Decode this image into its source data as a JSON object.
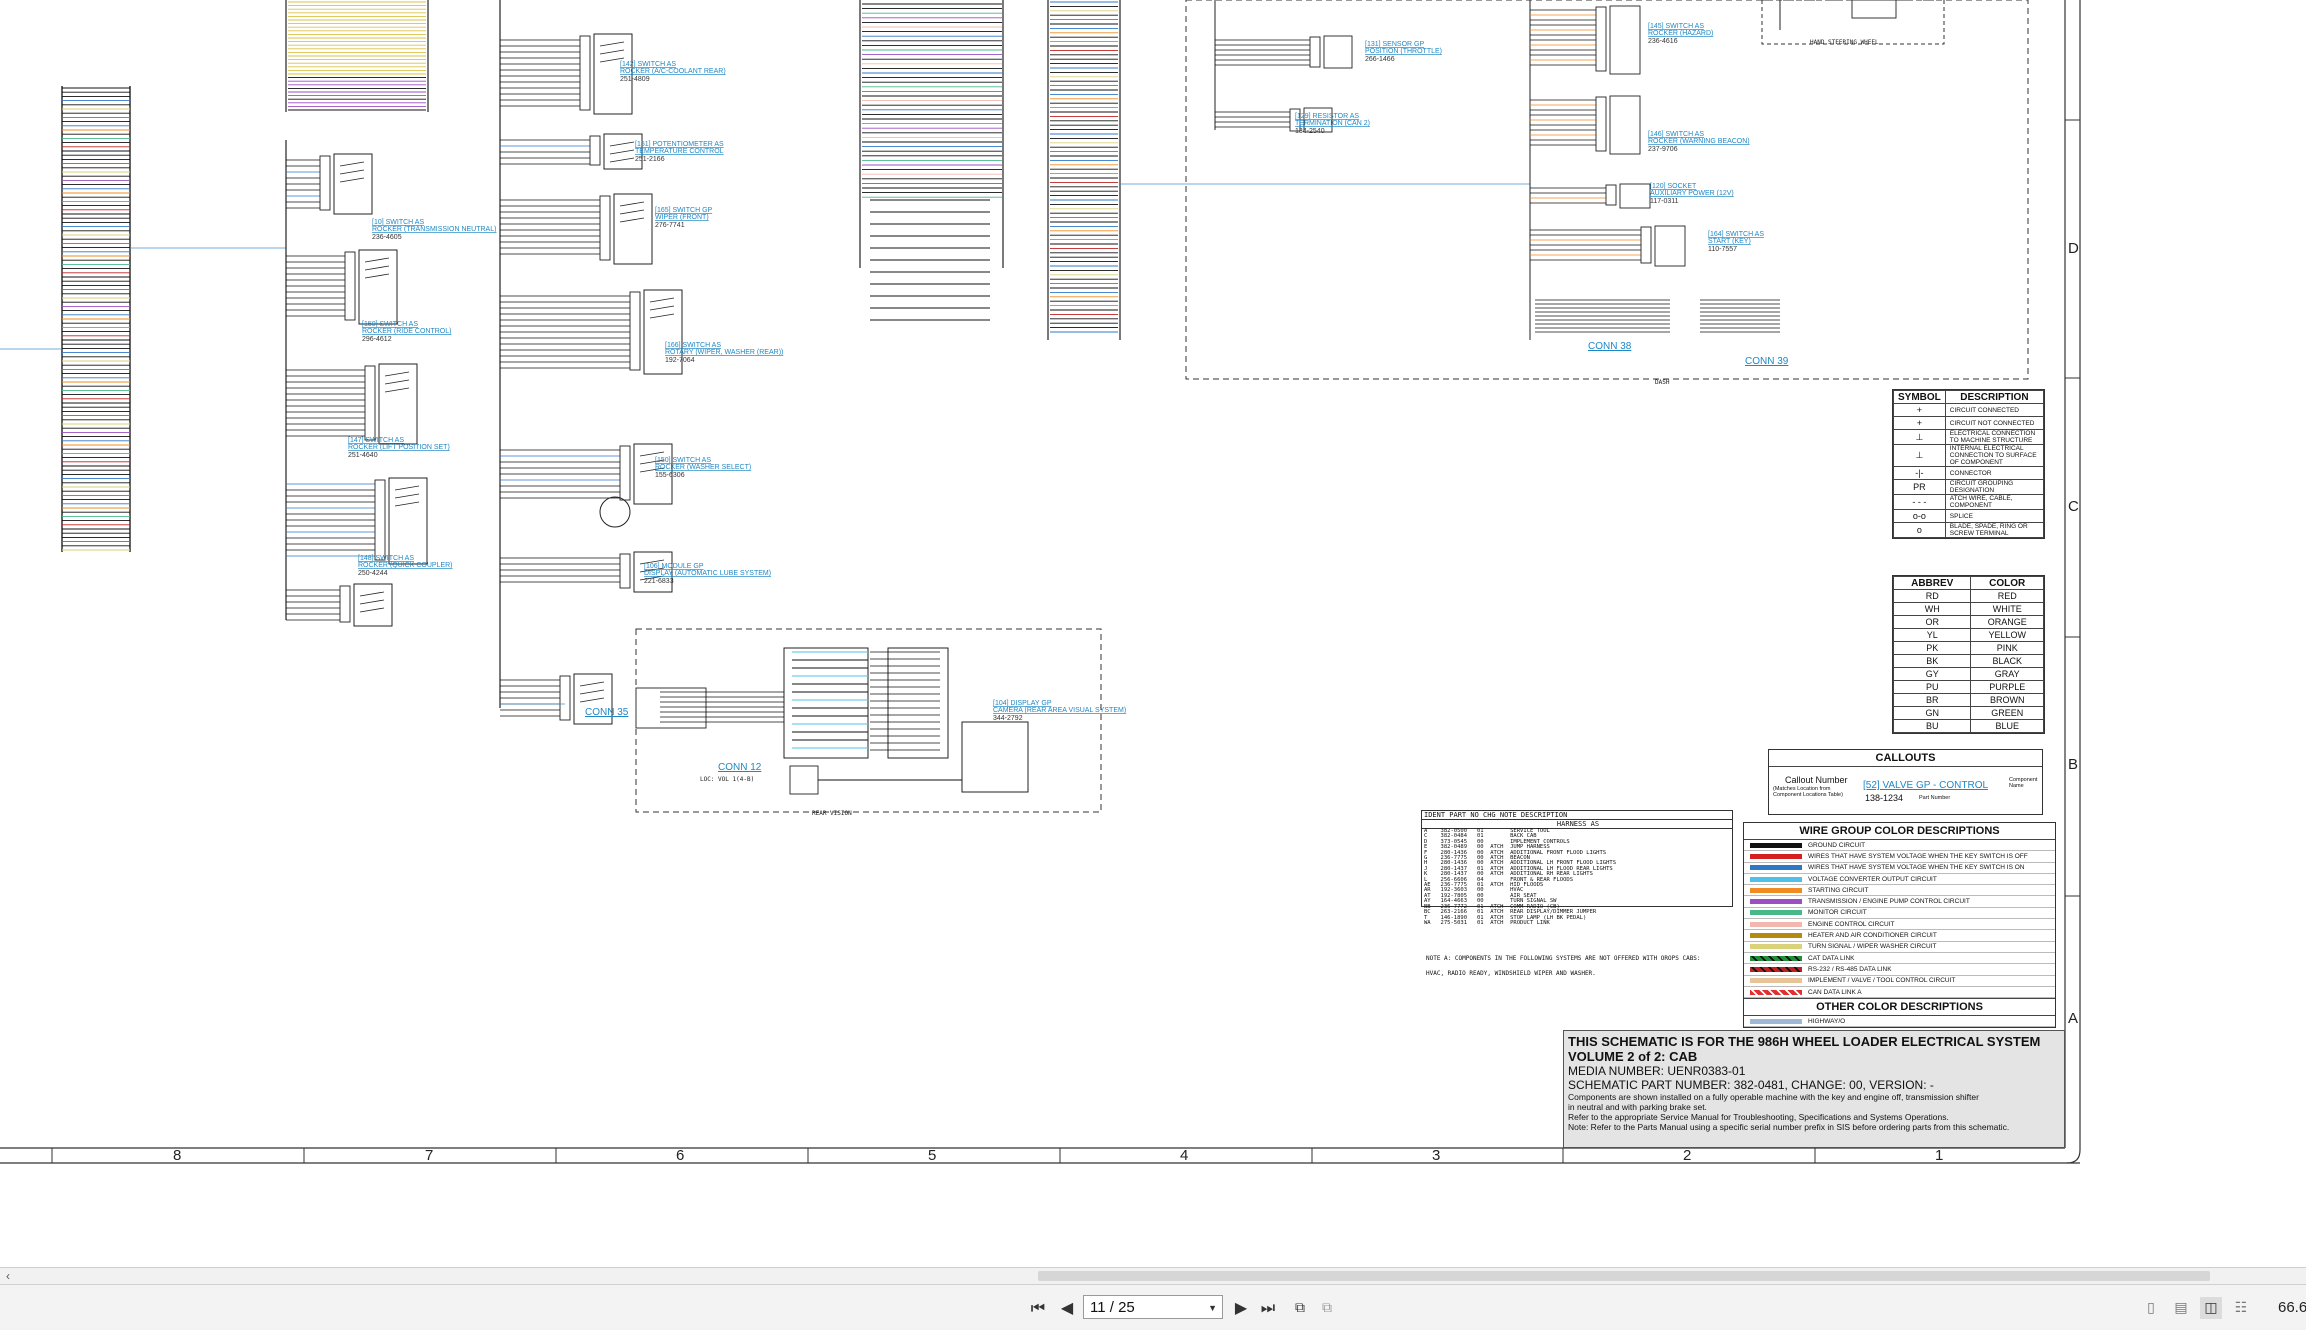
{
  "document": {
    "callouts": [
      {
        "ref": "[142] SWITCH AS",
        "name": "ROCKER (A/C-COOLANT REAR)",
        "part": "251-4809"
      },
      {
        "ref": "[151] POTENTIOMETER AS",
        "name": "TEMPERATURE CONTROL",
        "part": "251-2166"
      },
      {
        "ref": "[10] SWITCH AS",
        "name": "ROCKER (TRANSMISSION NEUTRAL)",
        "part": "236-4605"
      },
      {
        "ref": "[165] SWITCH GP",
        "name": "WIPER (FRONT)",
        "part": "276-7741"
      },
      {
        "ref": "[150] SWITCH AS",
        "name": "ROCKER (RIDE CONTROL)",
        "part": "296-4612"
      },
      {
        "ref": "[166] SWITCH AS",
        "name": "ROTARY (WIPER, WASHER (REAR))",
        "part": "192-7064"
      },
      {
        "ref": "[147] SWITCH AS",
        "name": "ROCKER (LIFT POSITION SET)",
        "part": "251-4640"
      },
      {
        "ref": "[150] SWITCH AS",
        "name": "ROCKER (WASHER SELECT)",
        "part": "155-6306"
      },
      {
        "ref": "[148] SWITCH AS",
        "name": "ROCKER (QUICK COUPLER)",
        "part": "250-4244"
      },
      {
        "ref": "[106] MODULE GP",
        "name": "DISPLAY (AUTOMATIC LUBE SYSTEM)",
        "part": "221-6833"
      },
      {
        "ref": "[104] DISPLAY GP",
        "name": "CAMERA (REAR AREA VISUAL SYSTEM)",
        "part": "344-2792"
      },
      {
        "ref": "[131] SENSOR GP",
        "name": "POSITION (THROTTLE)",
        "part": "266-1466"
      },
      {
        "ref": "[129] RESISTOR AS",
        "name": "TERMINATION (CAN 2)",
        "part": "134-2540"
      },
      {
        "ref": "[145] SWITCH AS",
        "name": "ROCKER (HAZARD)",
        "part": "236-4616"
      },
      {
        "ref": "[146] SWITCH AS",
        "name": "ROCKER (WARNING BEACON)",
        "part": "237-9706"
      },
      {
        "ref": "[120] SOCKET",
        "name": "AUXILIARY POWER (12V)",
        "part": "117-0311"
      },
      {
        "ref": "[164] SWITCH AS",
        "name": "START (KEY)",
        "part": "110-7557"
      }
    ],
    "connectors": [
      "CONN 35",
      "CONN 12",
      "CONN 38",
      "CONN 39"
    ],
    "misc_labels": [
      "REAR VISION",
      "DASH",
      "HAND STEERING WHEEL",
      "LOC: VOL 1(4-B)"
    ],
    "column_numbers": [
      "8",
      "7",
      "6",
      "5",
      "4",
      "3",
      "2",
      "1"
    ],
    "row_letters": [
      "D",
      "C",
      "B",
      "A"
    ]
  },
  "symbol_legend": {
    "headers": [
      "SYMBOL",
      "DESCRIPTION"
    ],
    "rows": [
      {
        "glyph": "+",
        "desc": "CIRCUIT CONNECTED"
      },
      {
        "glyph": "+",
        "desc": "CIRCUIT NOT CONNECTED"
      },
      {
        "glyph": "⊥",
        "desc": "ELECTRICAL CONNECTION TO MACHINE STRUCTURE"
      },
      {
        "glyph": "⊥",
        "desc": "INTERNAL ELECTRICAL CONNECTION TO SURFACE OF COMPONENT"
      },
      {
        "glyph": "-|-",
        "desc": "CONNECTOR"
      },
      {
        "glyph": "PR",
        "desc": "CIRCUIT GROUPING DESIGNATION"
      },
      {
        "glyph": "- - -",
        "desc": "ATCH WIRE, CABLE, COMPONENT"
      },
      {
        "glyph": "o-o",
        "desc": "SPLICE"
      },
      {
        "glyph": "o",
        "desc": "BLADE, SPADE, RING OR SCREW TERMINAL"
      }
    ]
  },
  "color_abbrev": {
    "headers": [
      "ABBREV",
      "COLOR"
    ],
    "rows": [
      [
        "RD",
        "RED"
      ],
      [
        "WH",
        "WHITE"
      ],
      [
        "OR",
        "ORANGE"
      ],
      [
        "YL",
        "YELLOW"
      ],
      [
        "PK",
        "PINK"
      ],
      [
        "BK",
        "BLACK"
      ],
      [
        "GY",
        "GRAY"
      ],
      [
        "PU",
        "PURPLE"
      ],
      [
        "BR",
        "BROWN"
      ],
      [
        "GN",
        "GREEN"
      ],
      [
        "BU",
        "BLUE"
      ]
    ]
  },
  "callouts_box": {
    "title": "CALLOUTS",
    "callout_number": "Callout Number",
    "callout_note": "(Matches Location from Component Locations Table)",
    "example": "[52] VALVE GP - CONTROL",
    "part": "138-1234",
    "part_label": "Part Number",
    "component_name": "Component Name"
  },
  "wire_groups": {
    "title": "WIRE GROUP COLOR DESCRIPTIONS",
    "rows": [
      {
        "color": "#111111",
        "desc": "GROUND CIRCUIT"
      },
      {
        "color": "#d42020",
        "desc": "WIRES THAT HAVE SYSTEM VOLTAGE WHEN THE KEY SWITCH IS OFF"
      },
      {
        "color": "#2f78c8",
        "desc": "WIRES THAT HAVE SYSTEM VOLTAGE WHEN THE KEY SWITCH IS ON"
      },
      {
        "color": "#4fc0e8",
        "desc": "VOLTAGE CONVERTER OUTPUT CIRCUIT"
      },
      {
        "color": "#f08a22",
        "desc": "STARTING CIRCUIT"
      },
      {
        "color": "#9b4fc2",
        "desc": "TRANSMISSION / ENGINE PUMP CONTROL CIRCUIT"
      },
      {
        "color": "#48b888",
        "desc": "MONITOR CIRCUIT"
      },
      {
        "color": "#f2b8b0",
        "desc": "ENGINE CONTROL CIRCUIT"
      },
      {
        "color": "#b58a10",
        "desc": "HEATER AND AIR CONDITIONER CIRCUIT"
      },
      {
        "color": "#d9d27a",
        "desc": "TURN SIGNAL / WIPER WASHER CIRCUIT"
      },
      {
        "color": "repeating-linear-gradient(45deg,#1f8f3a 0 4px,#111 4px 6px)",
        "desc": "CAT DATA LINK"
      },
      {
        "color": "repeating-linear-gradient(45deg,#c02020 0 4px,#111 4px 6px)",
        "desc": "RS-232 / RS-485 DATA LINK"
      },
      {
        "color": "#e8c49a",
        "desc": "IMPLEMENT / VALVE / TOOL CONTROL CIRCUIT"
      },
      {
        "color": "repeating-linear-gradient(45deg,#e03030 0 4px,#ffffff 4px 6px)",
        "desc": "CAN DATA LINK A"
      }
    ],
    "other_title": "OTHER COLOR DESCRIPTIONS",
    "other_rows": [
      {
        "color": "#9fb8d8",
        "desc": "HIGHWAY/O"
      }
    ]
  },
  "parts_list": {
    "header": "IDENT  PART NO    CHG  NOTE  DESCRIPTION",
    "subheader": "HARNESS AS",
    "rows": [
      "A    382-0500   01        SERVICE TOOL",
      "C    382-0484   01        BACK CAB",
      "D    373-0545   00        IMPLEMENT CONTROLS",
      "E    382-0489   00  ATCH  JUMP HARNESS",
      "F    280-1436   00  ATCH  ADDITIONAL FRONT FLOOD LIGHTS",
      "G    236-7775   00  ATCH  BEACON",
      "H    280-1436   00  ATCH  ADDITIONAL LH FRONT FLOOD LIGHTS",
      "J    280-1437   01  ATCH  ADDITIONAL LH FLOOD REAR LIGHTS",
      "K    280-1437   00  ATCH  ADDITIONAL RH REAR LIGHTS",
      "L    256-6606   04        FRONT & REAR FLOODS",
      "AE   236-7775   01  ATCH  HID FLOODS",
      "AR   192-3603   00        HVAC",
      "AT   192-7805   00        AIR SEAT",
      "AY   164-4663   00        TURN SIGNAL SW",
      "BB   236-7772   01  ATCH  COMM RADIO (CB)",
      "BC   263-2166   01  ATCH  REAR DISPLAY/DIMMER JUMPER",
      "T    146-1890   01  ATCH  STOP LAMP (LH BK PEDAL)",
      "WA   275-5031   01  ATCH  PRODUCT LINK"
    ],
    "note1": "NOTE A: COMPONENTS IN THE FOLLOWING SYSTEMS ARE NOT OFFERED WITH OROPS CABS:",
    "note2": "HVAC, RADIO READY, WINDSHIELD WIPER AND WASHER."
  },
  "title_block": {
    "line1": "THIS SCHEMATIC IS FOR THE 986H WHEEL LOADER ELECTRICAL SYSTEM",
    "line2": "VOLUME 2 of 2: CAB",
    "media": "MEDIA NUMBER: UENR0383-01",
    "part": "SCHEMATIC PART NUMBER: 382-0481, CHANGE: 00, VERSION: -",
    "note1": "Components are shown installed on a fully operable machine with the key and engine off, transmission shifter",
    "note2": "in neutral and with parking brake set.",
    "note3": "Refer to the appropriate Service Manual for Troubleshooting, Specifications and Systems Operations.",
    "note4": "Note: Refer to the Parts Manual using a specific serial number prefix in SIS before ordering parts from this schematic."
  },
  "viewer": {
    "page_indicator": "11 / 25",
    "zoom": "66.6",
    "icons": [
      "first-page-icon",
      "prev-page-icon",
      "next-page-icon",
      "last-page-icon",
      "fit-page-icon",
      "fit-width-icon",
      "single-page-icon",
      "continuous-page-icon",
      "two-page-icon",
      "two-page-continuous-icon",
      "scroll-left-icon"
    ]
  }
}
